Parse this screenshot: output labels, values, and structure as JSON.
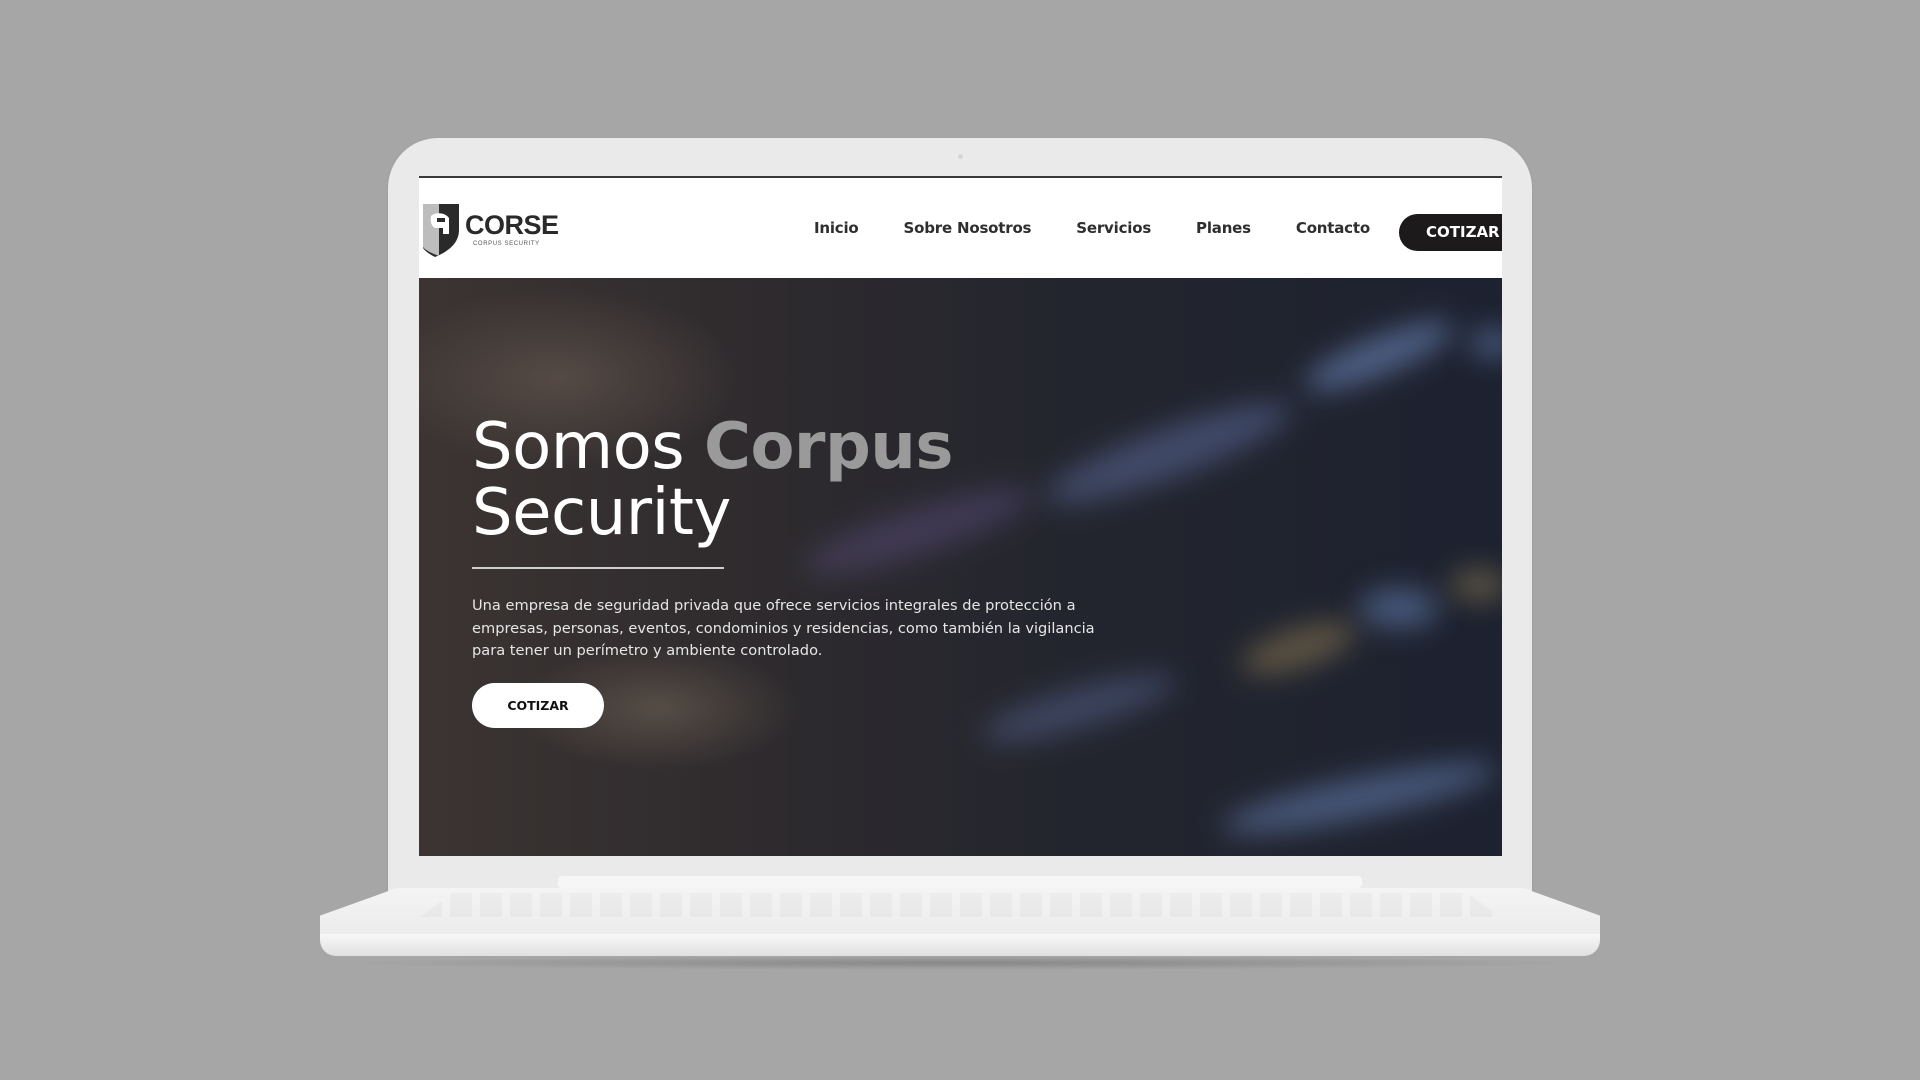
{
  "brand": {
    "name": "CORSE",
    "tagline": "CORPUS SECURITY"
  },
  "nav": {
    "links": [
      "Inicio",
      "Sobre Nosotros",
      "Servicios",
      "Planes",
      "Contacto"
    ],
    "cta_label": "COTIZAR"
  },
  "hero": {
    "title_part1": "Somos ",
    "title_accent": "Corpus",
    "title_part2": "Security",
    "description": "Una empresa de seguridad privada que ofrece servicios integrales de protección a empresas, personas, eventos, condominios y residencias, como también la vigilancia para tener un perímetro y ambiente controlado.",
    "cta_label": "COTIZAR"
  },
  "colors": {
    "background": "#a6a6a6",
    "nav_cta_bg": "#1c1a1a",
    "title_accent": "#9a9a9a",
    "hero_bg_dark": "#1d2230"
  },
  "icons": {
    "logo": "shield-helmet-icon"
  }
}
